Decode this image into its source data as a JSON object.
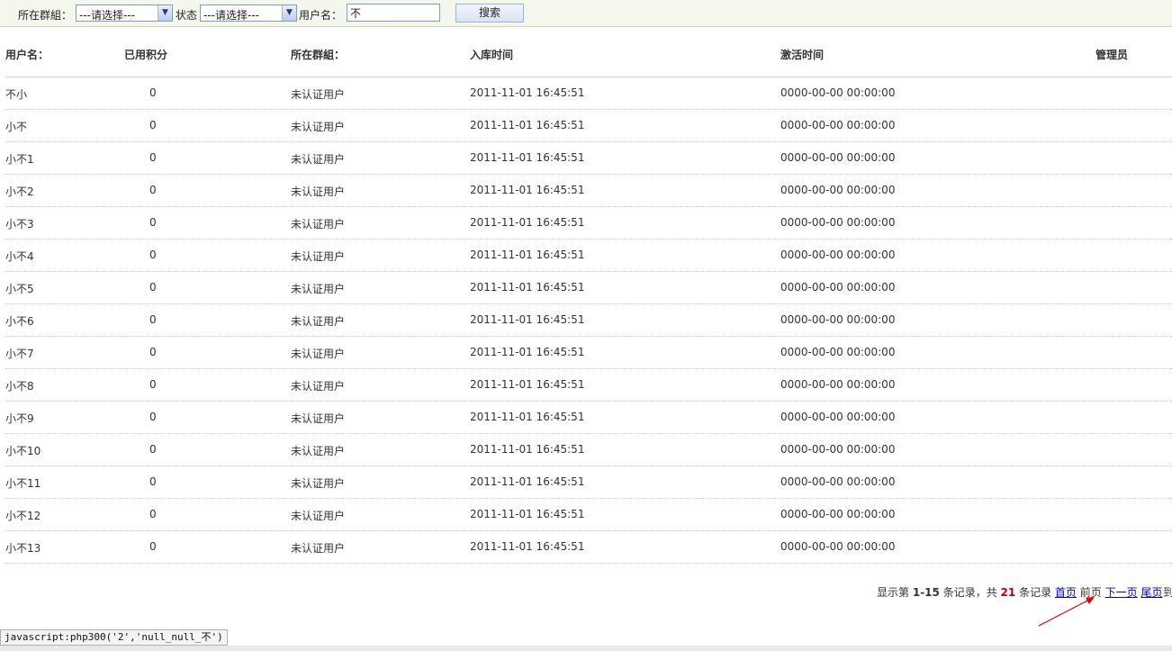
{
  "toolbar": {
    "group_label": "所在群組：",
    "group_select": "---请选择---",
    "status_label": "状态",
    "status_select": "---请选择---",
    "username_label": "用户名：",
    "username_value": "不",
    "search_label": "搜索"
  },
  "table": {
    "headers": [
      "用户名：",
      "已用积分",
      "所在群組：",
      "入库时间",
      "激活时间",
      "管理员"
    ],
    "rows": [
      [
        "不小",
        "0",
        "未认证用户",
        "2011-11-01 16:45:51",
        "0000-00-00 00:00:00"
      ],
      [
        "小不",
        "0",
        "未认证用户",
        "2011-11-01 16:45:51",
        "0000-00-00 00:00:00"
      ],
      [
        "小不1",
        "0",
        "未认证用户",
        "2011-11-01 16:45:51",
        "0000-00-00 00:00:00"
      ],
      [
        "小不2",
        "0",
        "未认证用户",
        "2011-11-01 16:45:51",
        "0000-00-00 00:00:00"
      ],
      [
        "小不3",
        "0",
        "未认证用户",
        "2011-11-01 16:45:51",
        "0000-00-00 00:00:00"
      ],
      [
        "小不4",
        "0",
        "未认证用户",
        "2011-11-01 16:45:51",
        "0000-00-00 00:00:00"
      ],
      [
        "小不5",
        "0",
        "未认证用户",
        "2011-11-01 16:45:51",
        "0000-00-00 00:00:00"
      ],
      [
        "小不6",
        "0",
        "未认证用户",
        "2011-11-01 16:45:51",
        "0000-00-00 00:00:00"
      ],
      [
        "小不7",
        "0",
        "未认证用户",
        "2011-11-01 16:45:51",
        "0000-00-00 00:00:00"
      ],
      [
        "小不8",
        "0",
        "未认证用户",
        "2011-11-01 16:45:51",
        "0000-00-00 00:00:00"
      ],
      [
        "小不9",
        "0",
        "未认证用户",
        "2011-11-01 16:45:51",
        "0000-00-00 00:00:00"
      ],
      [
        "小不10",
        "0",
        "未认证用户",
        "2011-11-01 16:45:51",
        "0000-00-00 00:00:00"
      ],
      [
        "小不11",
        "0",
        "未认证用户",
        "2011-11-01 16:45:51",
        "0000-00-00 00:00:00"
      ],
      [
        "小不12",
        "0",
        "未认证用户",
        "2011-11-01 16:45:51",
        "0000-00-00 00:00:00"
      ],
      [
        "小不13",
        "0",
        "未认证用户",
        "2011-11-01 16:45:51",
        "0000-00-00 00:00:00"
      ]
    ]
  },
  "pager": {
    "prefix": "显示第",
    "range": "1-15",
    "mid": "条记录，共",
    "total": "21",
    "suffix": "条记录",
    "first": "首页",
    "prev": "前页",
    "next": "下一页",
    "last": "尾页",
    "goto": "到"
  },
  "statusbar": {
    "text": "javascript:php300('2','null_null_不')"
  },
  "colors": {
    "toolbar_bg": "#f4f8ec",
    "link": "#0000cc",
    "total_highlight": "#c00000",
    "annotation_arrow": "#e00000"
  }
}
